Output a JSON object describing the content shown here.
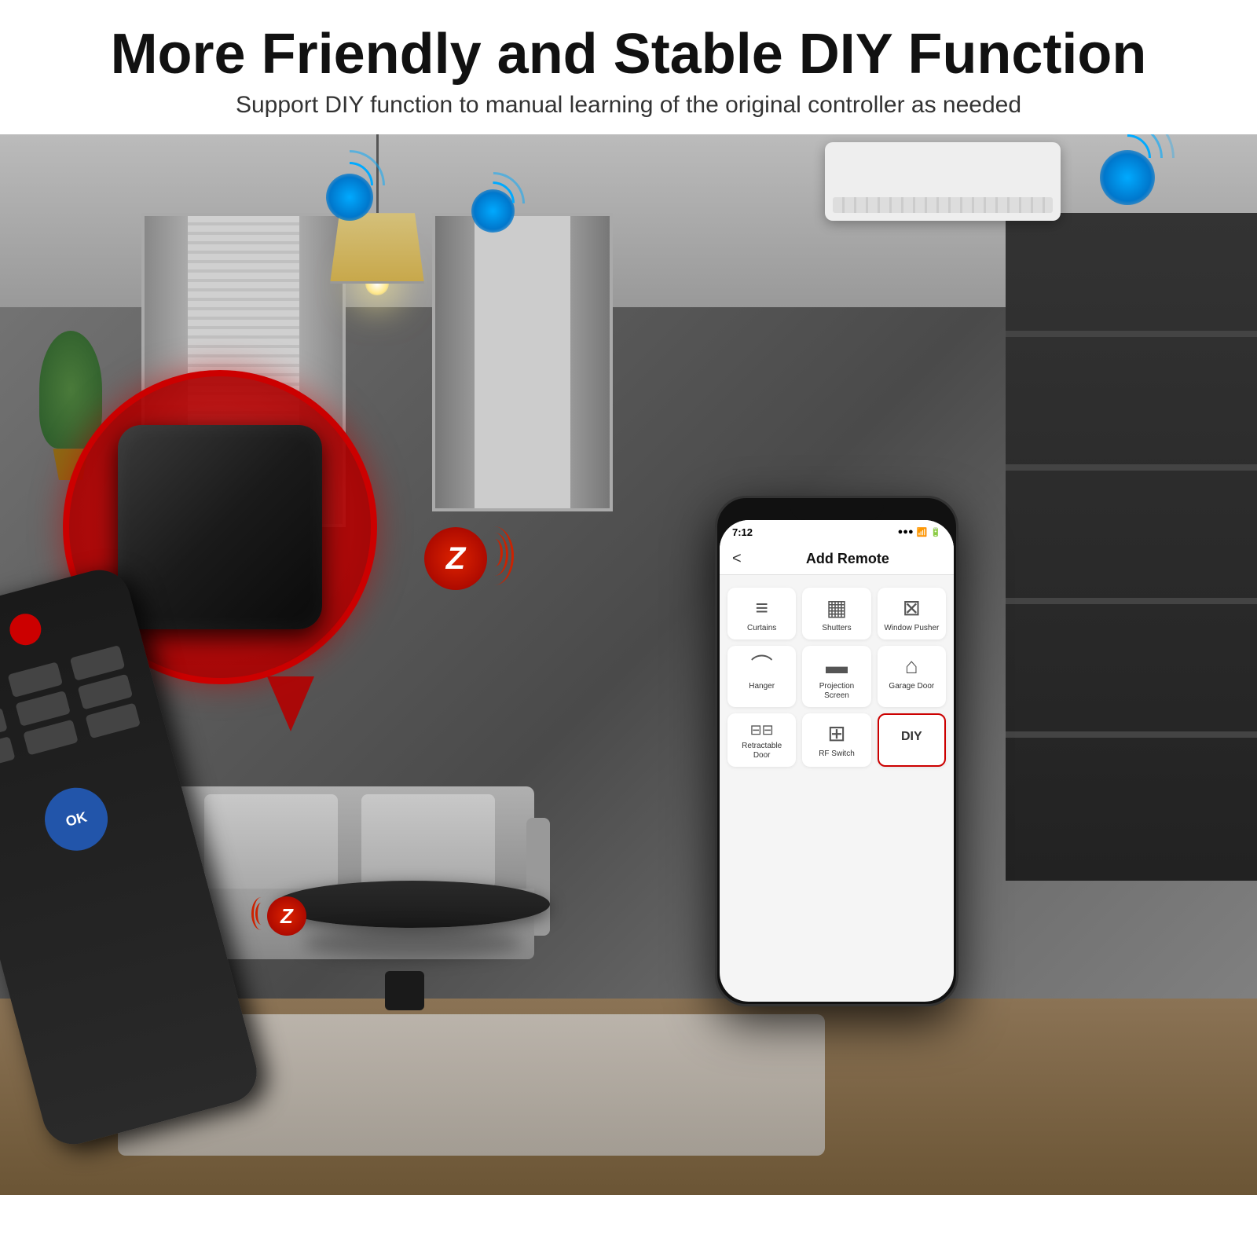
{
  "page": {
    "title": "More Friendly and Stable DIY Function",
    "subtitle": "Support DIY function to manual learning of the original controller as needed"
  },
  "header": {
    "title": "More Friendly and Stable DIY Function",
    "subtitle": "Support DIY function to manual learning of the original controller as needed"
  },
  "phone": {
    "status_bar": {
      "time": "7:12",
      "signal": "●●●",
      "wifi": "WiFi",
      "battery": "■"
    },
    "nav": {
      "back": "<",
      "title": "Add Remote"
    },
    "grid_items": [
      {
        "id": "curtains",
        "icon": "▦",
        "label": "Curtains",
        "highlighted": false
      },
      {
        "id": "shutters",
        "icon": "▤",
        "label": "Shutters",
        "highlighted": false
      },
      {
        "id": "window-pusher",
        "icon": "▣",
        "label": "Window Pusher",
        "highlighted": false
      },
      {
        "id": "hanger",
        "icon": "⌂",
        "label": "Hanger",
        "highlighted": false
      },
      {
        "id": "projection-screen",
        "icon": "▬",
        "label": "Projection Screen",
        "highlighted": false
      },
      {
        "id": "garage-door",
        "icon": "⌂",
        "label": "Garage Door",
        "highlighted": false
      },
      {
        "id": "retractable-door",
        "icon": "⊟",
        "label": "Retractable Door",
        "highlighted": false
      },
      {
        "id": "rf-switch",
        "icon": "⊞",
        "label": "RF Switch",
        "highlighted": false
      },
      {
        "id": "diy",
        "icon": "",
        "label": "DIY",
        "highlighted": true
      }
    ]
  },
  "device": {
    "name": "IR Remote Hub",
    "color": "#1a1a1a"
  },
  "labels": {
    "retractable_door": "Retractable Door",
    "rf_switch": "RF Switch",
    "diy": "DIY",
    "curtains": "Curtains",
    "shutters": "Shutters",
    "window_pusher": "Window Pusher",
    "hanger": "Hanger",
    "projection_screen": "Projection Screen",
    "garage_door": "Garage Door"
  }
}
